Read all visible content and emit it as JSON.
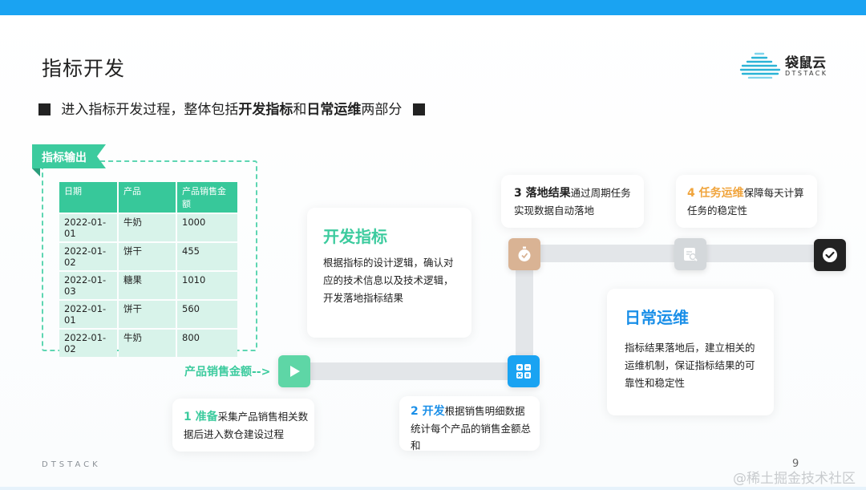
{
  "title": "指标开发",
  "logo": {
    "name": "袋鼠云",
    "sub": "DTSTACK"
  },
  "subtitle": {
    "prefix": "进入指标开发过程，整体包括",
    "bold1": "开发指标",
    "mid": "和",
    "bold2": "日常运维",
    "suffix": "两部分"
  },
  "output": {
    "tag": "指标输出",
    "columns": [
      "日期",
      "产品",
      "产品销售金额"
    ],
    "rows": [
      [
        "2022-01-01",
        "牛奶",
        "1000"
      ],
      [
        "2022-01-02",
        "饼干",
        "455"
      ],
      [
        "2022-01-03",
        "糖果",
        "1010"
      ],
      [
        "2022-01-01",
        "饼干",
        "560"
      ],
      [
        "2022-01-02",
        "牛奶",
        "800"
      ]
    ]
  },
  "dev_card": {
    "title": "开发指标",
    "text": "根据指标的设计逻辑，确认对应的技术信息以及技术逻辑，开发落地指标结果"
  },
  "ops_card": {
    "title": "日常运维",
    "text": "指标结果落地后，建立相关的运维机制，保证指标结果的可靠性和稳定性"
  },
  "flow_label": "产品销售金额-->",
  "steps": [
    {
      "num": "1 准备",
      "text": "采集产品销售相关数据后进入数仓建设过程"
    },
    {
      "num": "2 开发",
      "text": "根据销售明细数据统计每个产品的销售金额总和"
    },
    {
      "num": "3 落地结果",
      "text": "通过周期任务实现数据自动落地"
    },
    {
      "num": "4 任务运维",
      "text": "保障每天计算任务的稳定性"
    }
  ],
  "colors": {
    "accent_blue": "#1aa3f2",
    "green": "#3ccb9e",
    "dev_title": "#3ccb9e",
    "ops_title": "#1a8fe8",
    "step1": "#3ccb9e",
    "step2": "#1a8fe8",
    "step3": "#222222",
    "step4": "#f0a43c"
  },
  "footer": "DTSTACK",
  "page_number": "9",
  "watermark": "@稀土掘金技术社区"
}
